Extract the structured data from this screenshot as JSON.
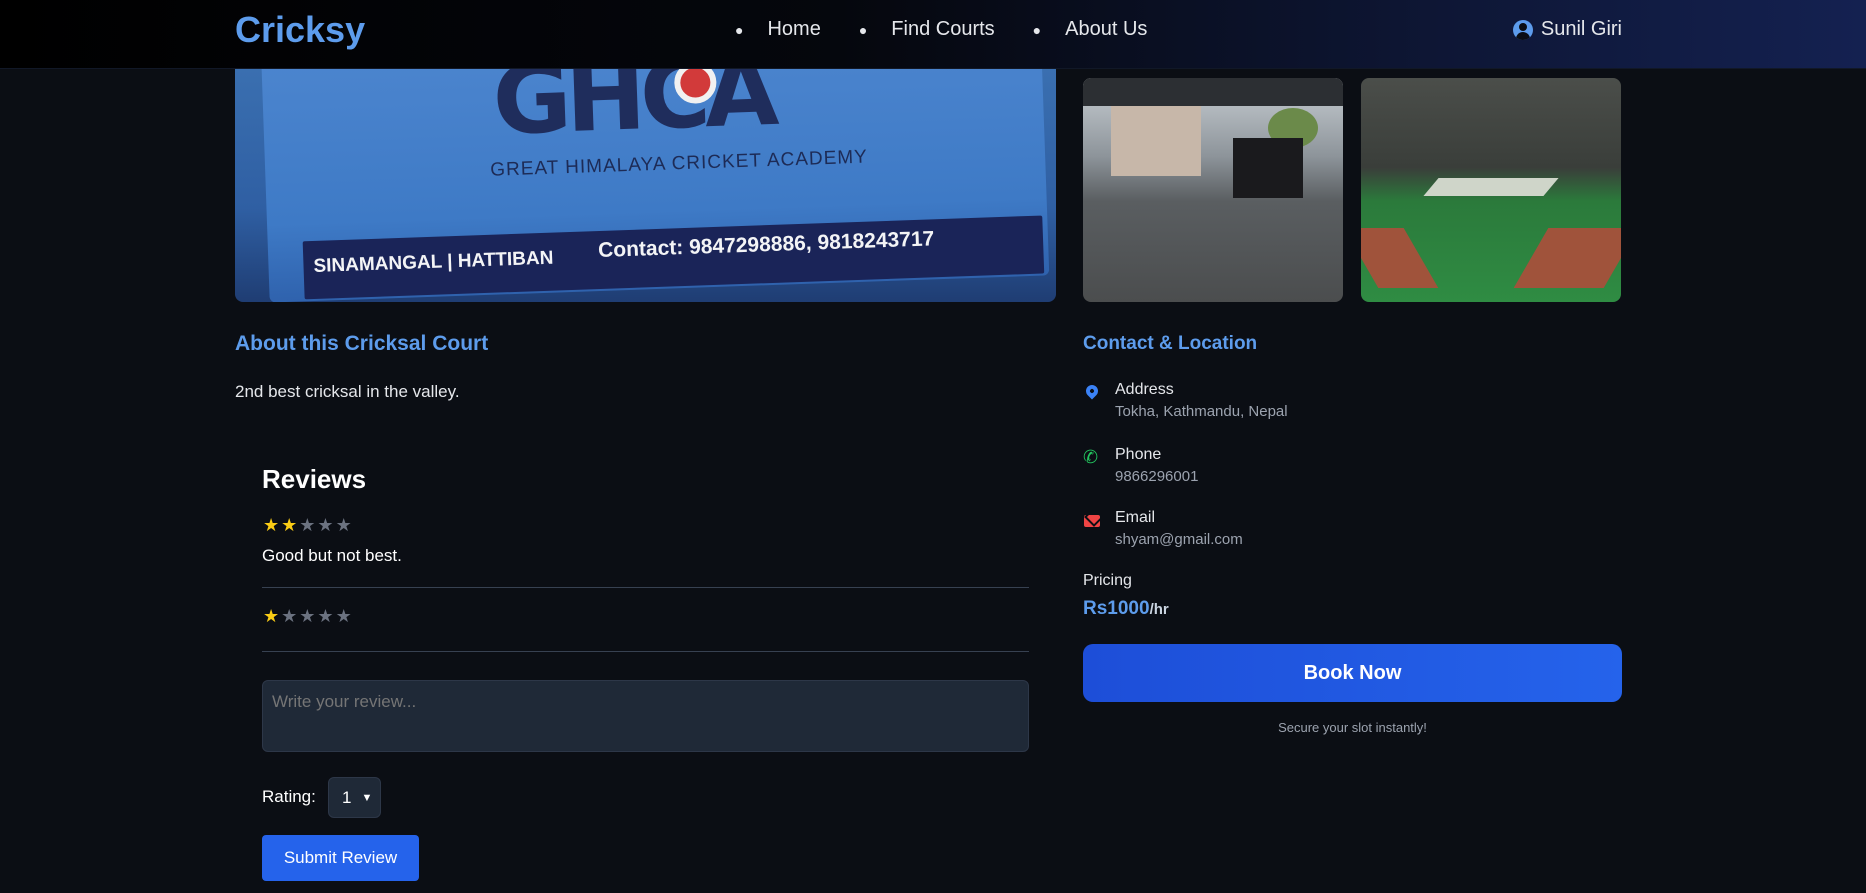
{
  "header": {
    "brand": "Cricksy",
    "nav": [
      "Home",
      "Find Courts",
      "About Us"
    ],
    "user_name": "Sunil Giri"
  },
  "gallery": {
    "main_photo": {
      "academy_name": "GREAT HIMALAYA CRICKET ACADEMY",
      "locations": "SINAMANGAL | HATTIBAN",
      "contact": "Contact: 9847298886, 9818243717"
    }
  },
  "about": {
    "title": "About this Cricksal Court",
    "description": "2nd best cricksal in the valley."
  },
  "reviews": {
    "title": "Reviews",
    "items": [
      {
        "rating": 2,
        "max": 5,
        "text": "Good but not best."
      },
      {
        "rating": 1,
        "max": 5,
        "text": ""
      }
    ],
    "input_placeholder": "Write your review...",
    "rating_label": "Rating:",
    "rating_value": "1",
    "submit_label": "Submit Review"
  },
  "contact": {
    "title": "Contact & Location",
    "address_label": "Address",
    "address_value": "Tokha, Kathmandu, Nepal",
    "phone_label": "Phone",
    "phone_value": "9866296001",
    "email_label": "Email",
    "email_value": "shyam@gmail.com",
    "pricing_label": "Pricing",
    "price": "Rs1000",
    "price_unit": "/hr",
    "book_label": "Book Now",
    "book_note": "Secure your slot instantly!"
  },
  "colors": {
    "brand": "#5d9cec",
    "primary_button": "#2563eb",
    "star_on": "#facc15",
    "star_off": "#6b7280",
    "phone_icon": "#22c55e",
    "email_icon": "#ef4444",
    "location_icon": "#3b82f6"
  }
}
